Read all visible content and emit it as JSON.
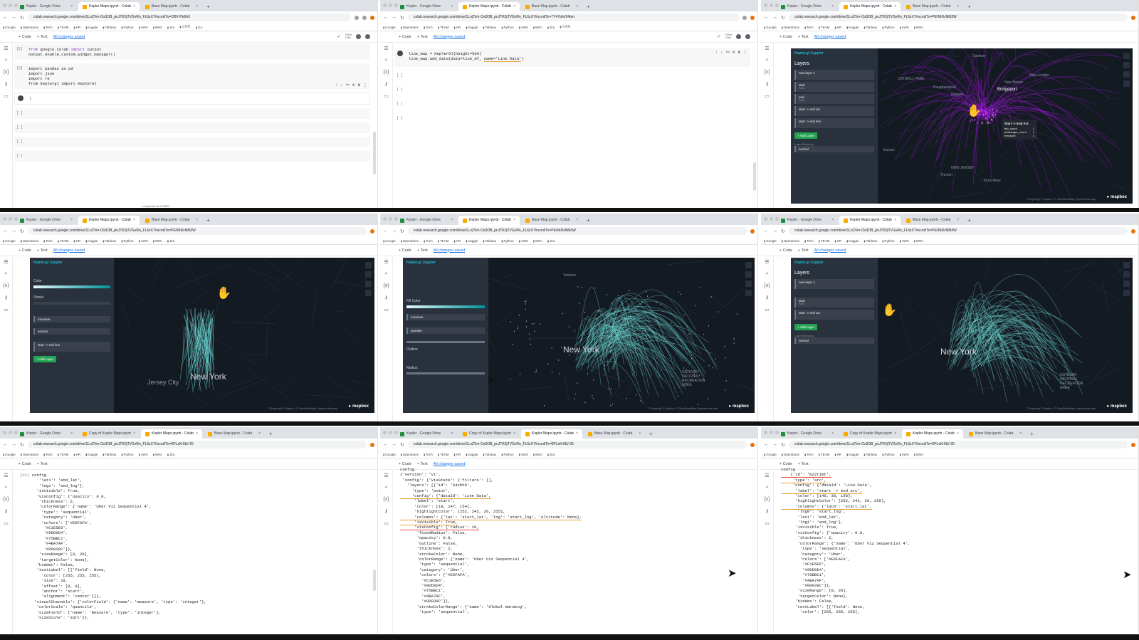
{
  "tabs": {
    "drive": "Kepler - Google Drive",
    "kepler": "Kepler Maps.ipynb - Colab",
    "base": "Base Map.ipynb - Colab",
    "copy": "Copy of Kepler Maps.ipynb",
    "close": "×",
    "new": "+"
  },
  "urls": {
    "p1": "colab.research.google.com/drive/1LoZVm-Os3OB_pnJTK0jTVGvRn_FL6zX7#scrollTo=OBY-Pb9hX",
    "p2": "colab.research.google.com/drive/1LoZVm-Os3OB_pnJTK0jTVGvRn_FL6zX7#scrollTo=7Y47dmf24bm",
    "p3": "colab.research.google.com/drive/1LoZVm-Os3OB_pnJTK0jTVGvRn_FL6zX7#scrollTo=PEINIRxN8t3W",
    "p7": "colab.research.google.com/drive/1LoZVm-Os3OB_pnJTK0jTVGvRn_FL6zX7#scrollTo=0PLxKr0tU-25"
  },
  "bookmarks": [
    "Google",
    "Operations",
    "Tech",
    "TEAM",
    "HR",
    "Kaggle",
    "Tableau",
    "Python",
    "AWS",
    "WIKI",
    "Jira",
    "스마트",
    "GA",
    "SSD",
    "텍스트"
  ],
  "colab": {
    "code": "+ Code",
    "text": "+ Text",
    "saved": "All changes saved",
    "ram": "RAM",
    "disk": "Disk"
  },
  "cells": {
    "c2_prompt": "[2]",
    "c2_l1_kw": "from",
    "c2_l1_rest": " google.colab ",
    "c2_l1_kw2": "import",
    "c2_l1_rest2": " output",
    "c2_l2": "output.enable_custom_widget_manager()",
    "c3_prompt": "[3]",
    "c3_l1": "import pandas as pd",
    "c3_l2": "import json",
    "c3_l3": "import re",
    "c3_l4": "from keplergl import KeplerGl",
    "empty": "[ ]",
    "status": "completed at 4:24PM",
    "map_l1": "line_map = KeplerGl(height=500)",
    "map_l2a": "line_map.add_data(data=line_df, ",
    "map_l2b": "name='Line Data'",
    "map_l2c": ")"
  },
  "kepler": {
    "brand": "Kepler.gl Jupyter",
    "layers": "Layers",
    "add_layer": "+ Add Layer",
    "layer_new": "new layer 1",
    "layer_start": "start",
    "layer_end": "end",
    "layer_start_end": "start -> end arc",
    "layer_start_end_line": "start -> end line",
    "layer_sub": "Point",
    "blending": "Layer Blending",
    "normal": "normal",
    "color": "Color",
    "stroke": "Stroke",
    "fill_color": "Fill Color",
    "radius": "Radius",
    "outline": "Outline",
    "quantile": "quantile",
    "measure": "measure",
    "basic": "Basic",
    "mapbox": "mapbox",
    "attribution": "© Kepler.gl | © Mapbox | © OpenStreetMap | Improve this map"
  },
  "tooltip": {
    "title": "Start -> End Arc",
    "r1k": "trip_count",
    "r1v": "1",
    "r2k": "passenger_count",
    "r2v": "1",
    "r3k": "measure",
    "r3v": "1"
  },
  "places": {
    "bridgeport": "Bridgeport",
    "newhaven": "New Haven",
    "newlondon": "New London",
    "newark": "Newark",
    "poughkeepsie": "Poughkeepsie",
    "danbury": "Danbury",
    "easton": "Easton",
    "trenton": "Trenton",
    "newjersey": "NEW JERSEY",
    "tomsriver": "Toms River",
    "ny": "New York",
    "jc": "Jersey City",
    "yonkers": "Yonkers",
    "gateway": "GATEWAY NATIONAL RECREATION AREA",
    "catskill": "CATSKILL PARK"
  },
  "config": {
    "p7_prompt": "[21]",
    "p7_title": "config",
    "p7": [
      "        'lat1': 'end_lat',",
      "        'lng1': 'end_lng'},",
      "       'isVisible': True,",
      "       'visConfig': {'opacity': 0.8,",
      "        'thickness': 2,",
      "        'colorRange': {'name': 'Uber Viz Sequential 4',",
      "         'type': 'sequential',",
      "         'category': 'Uber',",
      "         'colors': ['#E6FAFA',",
      "          '#C1E5E6',",
      "          '#9DD0D4',",
      "          '#75BBC1',",
      "          '#4BA7AF',",
      "          '#00939C']},",
      "        'sizeRange': [0, 20],",
      "        'targetColor': None},",
      "       'hidden': False,",
      "       'textLabel': [{'field': None,",
      "         'color': [255, 255, 255],",
      "         'size': 18,",
      "         'offset': [0, 0],",
      "         'anchor': 'start',",
      "         'alignment': 'center'}]},",
      "      'visualChannels': {'colorField': {'name': 'measure', 'type': 'integer'},",
      "       'colorScale': 'quantile',",
      "       'sizeField': {'name': 'measure', 'type': 'integer'},",
      "       'sizeScale': 'sqrt'}},"
    ],
    "p8_title": "config",
    "p8": [
      "{'version': 'v1',",
      " 'config': {'visState': {'filters': [],",
      "   'layers': [{'id': '64zbhb',",
      "     'type': 'point',",
      "     'config': {'dataId': 'Line Data',",
      "      'label': 'start',",
      "      'color': [18, 147, 154],",
      "      'highlightColor': [252, 242, 26, 255],",
      "      'columns': {'lat': 'start_lat', 'lng': 'start_lng', 'altitude': None},",
      "      'isVisible': True,",
      "      'visConfig': {'radius': 10,",
      "       'fixedRadius': False,",
      "       'opacity': 0.8,",
      "       'outline': False,",
      "       'thickness': 2,",
      "       'strokeColor': None,",
      "       'colorRange': {'name': 'Uber Viz Sequential 4',",
      "        'type': 'sequential',",
      "        'category': 'Uber',",
      "        'colors': ['#E6FAFA',",
      "         '#C1E5E6',",
      "         '#9DD0D4',",
      "         '#75BBC1',",
      "         '#4BA7AF',",
      "         '#00939C']},",
      "       'strokeColorRange': {'name': 'Global Warming',",
      "        'type': 'sequential',"
    ],
    "p9_title": "config",
    "p9": [
      "    {'id': 'mz2tjmt',",
      "     'type': 'arc',",
      "     'config': {'dataId': 'Line Data',",
      "      'label': 'start -> end arc',",
      "      'color': [146, 38, 198],",
      "      'highlightColor': [252, 242, 26, 255],",
      "      'columns': {'lat0': 'start_lat',",
      "       'lng0': 'start_lng',",
      "       'lat1': 'end_lat',",
      "       'lng1': 'end_lng'},",
      "      'isVisible': True,",
      "      'visConfig': {'opacity': 0.8,",
      "       'thickness': 2,",
      "       'colorRange': {'name': 'Uber Viz Sequential 4',",
      "        'type': 'sequential',",
      "        'category': 'Uber',",
      "        'colors': ['#E6FAFA',",
      "         '#C1E5E6',",
      "         '#9DD0D4',",
      "         '#75BBC1',",
      "         '#4BA7AF',",
      "         '#00939C']},",
      "       'sizeRange': [0, 20],",
      "       'targetColor': None},",
      "      'hidden': False,",
      "      'textLabel': [{'field': None,",
      "        'color': [255, 255, 255],"
    ]
  },
  "colors": {
    "arc_purple": "#a016e0",
    "teal": "#6fe0dc",
    "map_bg": "#141a22",
    "kepler_panel": "#29323c",
    "accent": "#1fbad6"
  }
}
